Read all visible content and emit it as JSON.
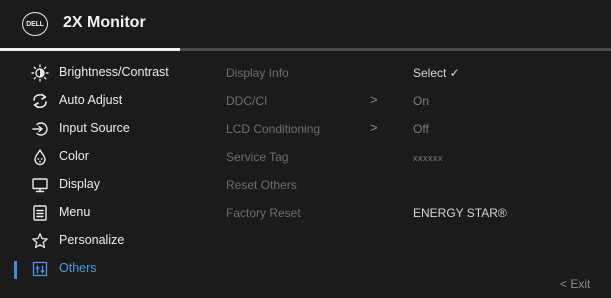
{
  "header": {
    "logo_text": "DELL",
    "title": "2X Monitor"
  },
  "progress": {
    "fraction": 0.295
  },
  "menu": {
    "items": [
      {
        "label": "Brightness/Contrast",
        "icon": "brightness-icon"
      },
      {
        "label": "Auto Adjust",
        "icon": "auto-adjust-icon"
      },
      {
        "label": "Input Source",
        "icon": "input-source-icon"
      },
      {
        "label": "Color",
        "icon": "color-icon"
      },
      {
        "label": "Display",
        "icon": "display-icon"
      },
      {
        "label": "Menu",
        "icon": "menu-icon"
      },
      {
        "label": "Personalize",
        "icon": "star-icon"
      },
      {
        "label": "Others",
        "icon": "others-icon",
        "active": true
      }
    ]
  },
  "settings": {
    "rows": [
      {
        "label": "Display Info",
        "value": "Select ✓"
      },
      {
        "label": "DDC/CI",
        "chevron": ">",
        "value": "On"
      },
      {
        "label": "LCD Conditioning",
        "chevron": ">",
        "value": "Off"
      },
      {
        "label": "Service Tag",
        "value": "xxxxxx"
      },
      {
        "label": "Reset Others",
        "value": ""
      },
      {
        "label": "Factory Reset",
        "value": "ENERGY STAR®"
      }
    ]
  },
  "footer": {
    "exit_label": "< Exit"
  },
  "colors": {
    "accent": "#3b8ee3",
    "background": "#1b1b1b",
    "text": "#ececec",
    "dim_text": "#6e6e6e"
  }
}
